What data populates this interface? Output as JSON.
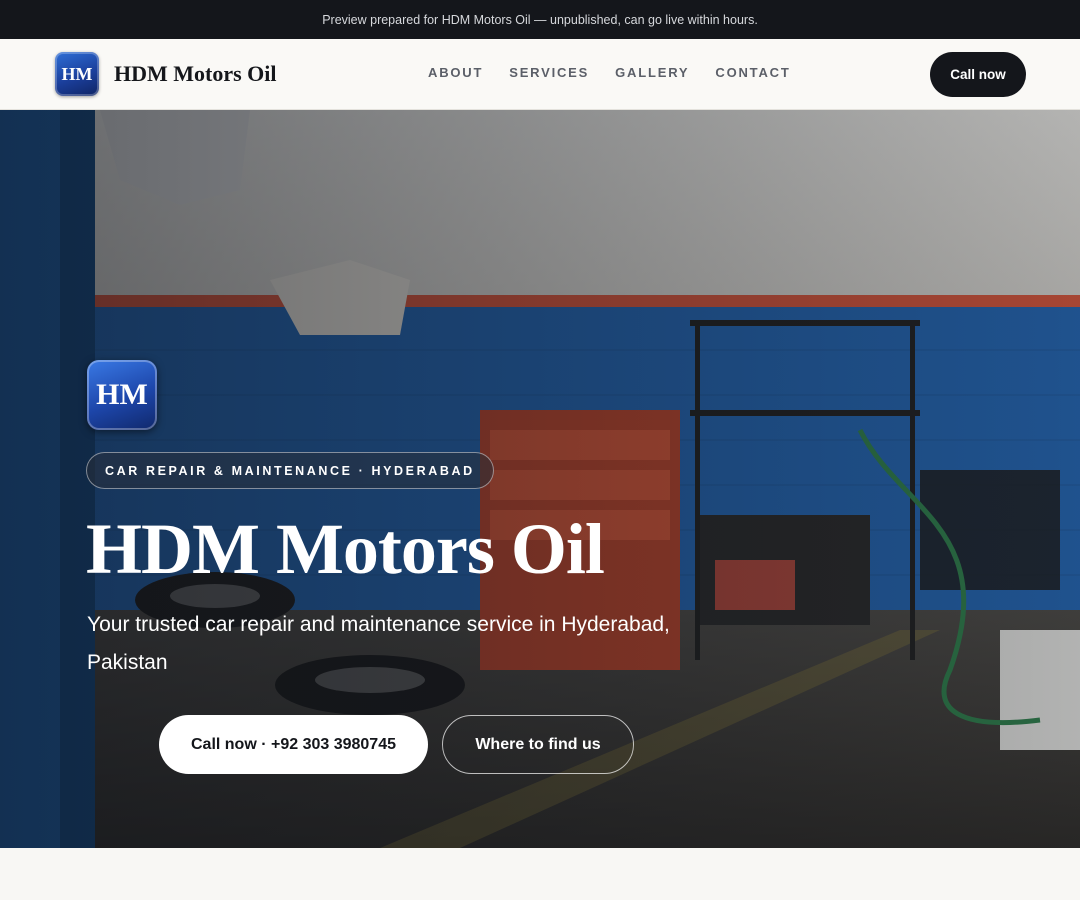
{
  "preview_banner": {
    "text": "Preview prepared for HDM Motors Oil — unpublished, can go live within hours."
  },
  "header": {
    "logo_initials": "HM",
    "brand_name": "HDM Motors Oil",
    "nav": [
      {
        "label": "ABOUT"
      },
      {
        "label": "SERVICES"
      },
      {
        "label": "GALLERY"
      },
      {
        "label": "CONTACT"
      }
    ],
    "call_button": "Call now"
  },
  "hero": {
    "logo_initials": "HM",
    "tag": "CAR REPAIR & MAINTENANCE · HYDERABAD",
    "title": "HDM Motors Oil",
    "subtitle": "Your trusted car repair and maintenance service in Hyderabad, Pakistan",
    "primary_button": "Call now · +92 303 3980745",
    "secondary_button": "Where to find us",
    "background_image": "garage-workshop-photo"
  },
  "colors": {
    "dark": "#14161b",
    "brand_blue": "#1d46aa",
    "page_bg": "#f8f7f4"
  }
}
